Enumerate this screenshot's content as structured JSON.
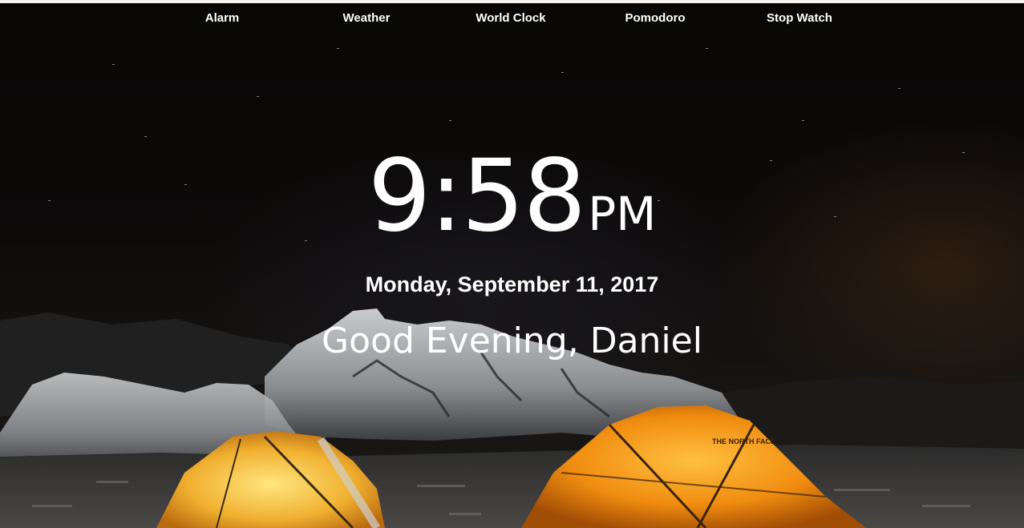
{
  "nav": {
    "items": [
      {
        "label": "Alarm"
      },
      {
        "label": "Weather"
      },
      {
        "label": "World Clock"
      },
      {
        "label": "Pomodoro"
      },
      {
        "label": "Stop Watch"
      }
    ]
  },
  "clock": {
    "time": "9:58",
    "ampm": "PM"
  },
  "date": "Monday, September 11, 2017",
  "greeting": "Good Evening, Daniel",
  "background": {
    "tent_logo_text": "THE NORTH FACE"
  },
  "colors": {
    "text": "#ffffff",
    "sky": "#0b0908",
    "tent": "#f0a020",
    "rock": "#b9bcbf"
  }
}
